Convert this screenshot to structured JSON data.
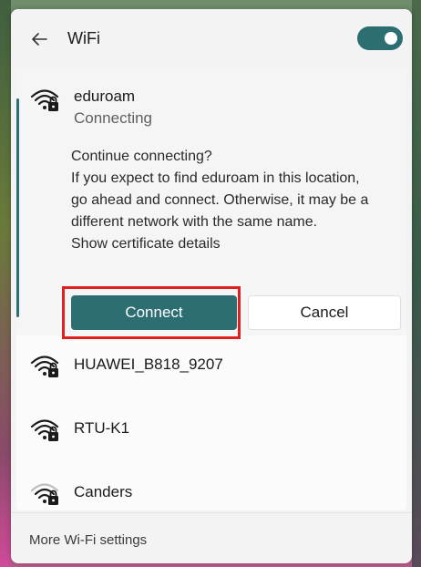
{
  "header": {
    "title": "WiFi",
    "back_icon": "arrow-left-icon",
    "toggle_state": "on"
  },
  "colors": {
    "accent": "#2d6e73",
    "highlight": "#e02020"
  },
  "expanded_network": {
    "name": "eduroam",
    "status": "Connecting",
    "icon": "wifi-secured-icon",
    "prompt_lines": [
      "Continue connecting?",
      "If you expect to find eduroam in this location,",
      "go ahead and connect. Otherwise, it may be a",
      "different network with the same name.",
      "Show certificate details"
    ],
    "connect_label": "Connect",
    "cancel_label": "Cancel"
  },
  "networks": [
    {
      "name": "HUAWEI_B818_9207",
      "icon": "wifi-secured-icon"
    },
    {
      "name": "RTU-K1",
      "icon": "wifi-secured-icon"
    },
    {
      "name": "Canders",
      "icon": "wifi-secured-icon"
    }
  ],
  "footer": {
    "link_label": "More Wi-Fi settings"
  }
}
